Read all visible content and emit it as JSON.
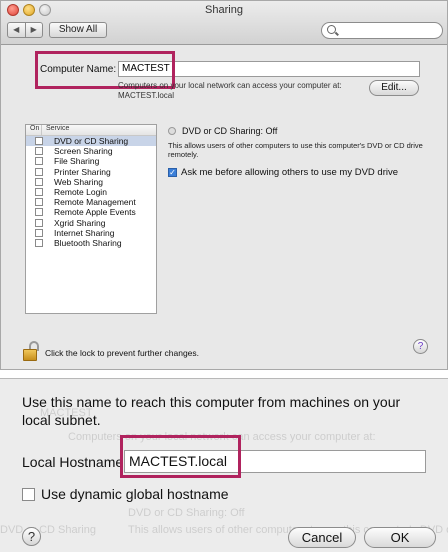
{
  "window": {
    "title": "Sharing",
    "nav_back": "◀",
    "nav_forward": "▶",
    "show_all": "Show All",
    "search": {
      "placeholder": "",
      "icon": "search-icon"
    }
  },
  "computer_name": {
    "label": "Computer Name:",
    "value": "MACTEST",
    "info_line1": "Computers on your local network can access your computer at:",
    "info_line2": "MACTEST.local",
    "edit_button": "Edit..."
  },
  "services": {
    "header_on": "On",
    "header_service": "Service",
    "items": [
      {
        "label": "DVD or CD Sharing",
        "selected": true
      },
      {
        "label": "Screen Sharing"
      },
      {
        "label": "File Sharing"
      },
      {
        "label": "Printer Sharing"
      },
      {
        "label": "Web Sharing"
      },
      {
        "label": "Remote Login"
      },
      {
        "label": "Remote Management"
      },
      {
        "label": "Remote Apple Events"
      },
      {
        "label": "Xgrid Sharing"
      },
      {
        "label": "Internet Sharing"
      },
      {
        "label": "Bluetooth Sharing"
      }
    ]
  },
  "detail": {
    "status": "DVD or CD Sharing: Off",
    "description": "This allows users of other computers to use this computer's DVD or CD drive remotely.",
    "ask_label": "Ask me before allowing others to use my DVD drive",
    "ask_checked": true
  },
  "lock": {
    "text": "Click the lock to prevent further changes."
  },
  "help": "?",
  "sheet": {
    "message": "Use this name to reach this computer from machines on your local subnet.",
    "hostname_label": "Local Hostname:",
    "hostname_value": "MACTEST.local",
    "dynamic_label": "Use dynamic global hostname",
    "cancel": "Cancel",
    "ok": "OK",
    "help": "?"
  },
  "colors": {
    "highlight": "#b0235e",
    "selection": "#c8d4e8"
  }
}
